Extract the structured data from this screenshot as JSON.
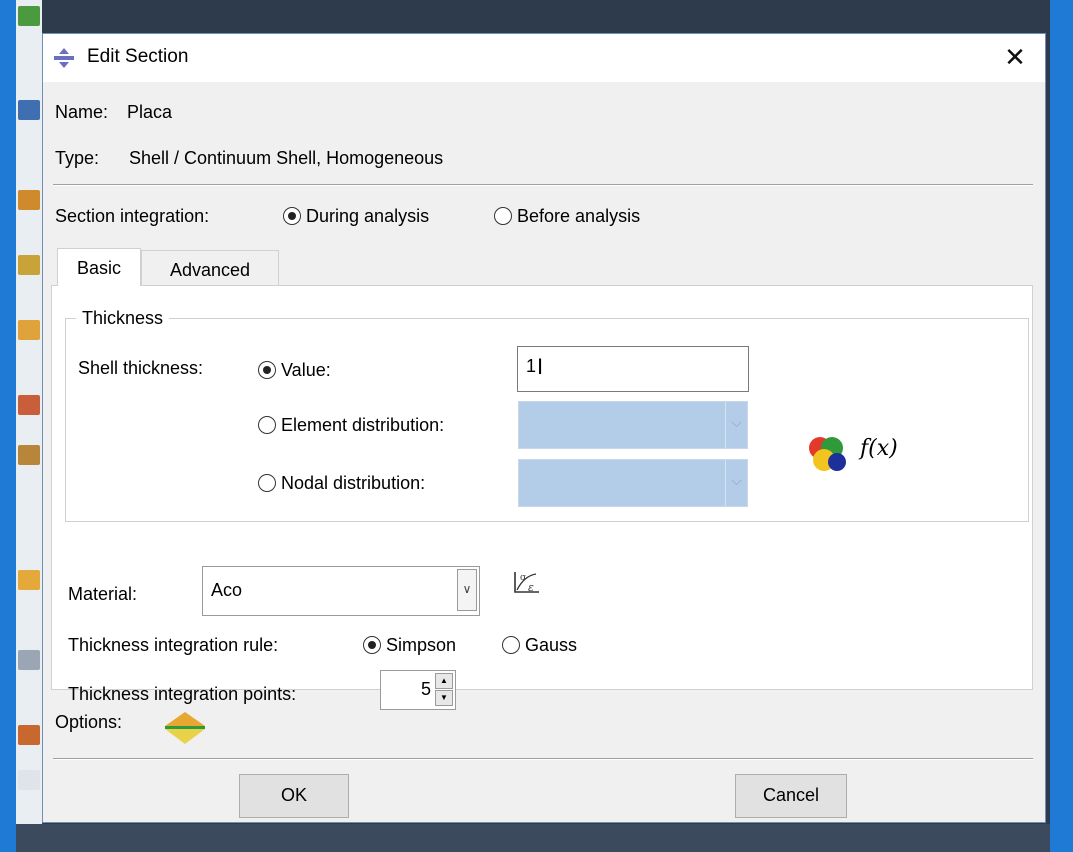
{
  "dialog": {
    "title": "Edit Section",
    "close_glyph": "✕",
    "name_label": "Name:",
    "name_value": "Placa",
    "type_label": "Type:",
    "type_value": "Shell / Continuum Shell, Homogeneous",
    "section_integration": {
      "label": "Section integration:",
      "options": [
        "During analysis",
        "Before analysis"
      ],
      "selected": "During analysis"
    },
    "tabs": [
      {
        "label": "Basic",
        "active": true
      },
      {
        "label": "Advanced",
        "active": false
      }
    ],
    "thickness_group": {
      "title": "Thickness",
      "shell_thickness_label": "Shell thickness:",
      "value_option": "Value:",
      "value_input": "1",
      "element_distribution": "Element distribution:",
      "nodal_distribution": "Nodal distribution:",
      "selected": "Value:",
      "fx_label": "f(x)"
    },
    "material": {
      "label": "Material:",
      "value": "Aco"
    },
    "thickness_integration_rule": {
      "label": "Thickness integration rule:",
      "options": [
        "Simpson",
        "Gauss"
      ],
      "selected": "Simpson"
    },
    "thickness_integration_points": {
      "label": "Thickness integration points:",
      "value": "5"
    },
    "options_label": "Options:",
    "ok_label": "OK",
    "cancel_label": "Cancel"
  },
  "colors": {
    "accent_blue": "#1f7ad6",
    "disabled_combo": "#b3cde8",
    "app_dark": "#2d3b4d"
  }
}
